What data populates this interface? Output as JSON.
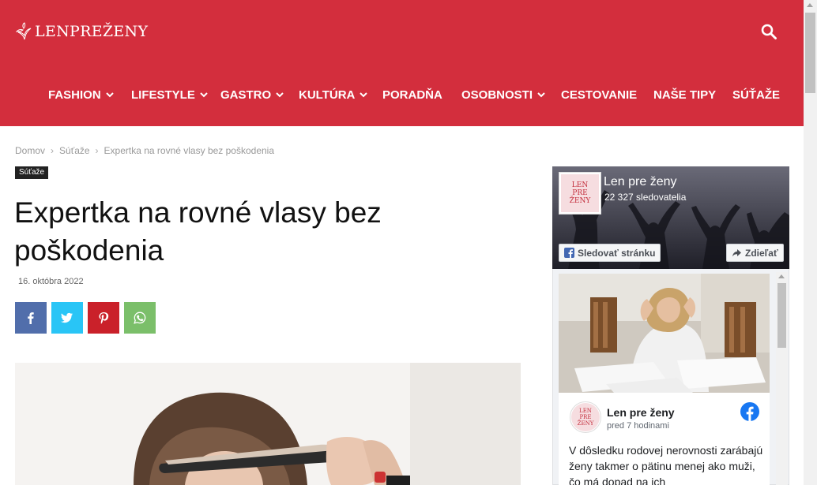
{
  "header": {
    "logo_text": "LENPREŽENY",
    "nav": [
      {
        "label": "FASHION",
        "has_dropdown": true
      },
      {
        "label": "LIFESTYLE",
        "has_dropdown": true
      },
      {
        "label": "GASTRO",
        "has_dropdown": true
      },
      {
        "label": "KULTÚRA",
        "has_dropdown": true
      },
      {
        "label": "PORADŇA",
        "has_dropdown": false
      },
      {
        "label": "OSOBNOSTI",
        "has_dropdown": true
      },
      {
        "label": "CESTOVANIE",
        "has_dropdown": false
      },
      {
        "label": "NAŠE TIPY",
        "has_dropdown": false
      },
      {
        "label": "SÚŤAŽE",
        "has_dropdown": false
      }
    ],
    "brand_color": "#d32e3d"
  },
  "breadcrumb": [
    "Domov",
    "Súťaže",
    "Expertka na rovné vlasy bez poškodenia"
  ],
  "article": {
    "category": "Súťaže",
    "title_line1": "Expertka na rovné vlasy bez",
    "title_line2": "poškodenia",
    "date": "16. októbra 2022",
    "share": [
      {
        "network": "facebook",
        "icon": "facebook-icon",
        "color": "#516eab"
      },
      {
        "network": "twitter",
        "icon": "twitter-icon",
        "color": "#29c5f6"
      },
      {
        "network": "pinterest",
        "icon": "pinterest-icon",
        "color": "#ca212a"
      },
      {
        "network": "whatsapp",
        "icon": "whatsapp-icon",
        "color": "#7bbf6a"
      }
    ]
  },
  "sidebar": {
    "fb_page": {
      "name": "Len pre ženy",
      "followers": "22 327 sledovatelia",
      "follow_label": "Sledovať stránku",
      "share_label": "Zdieľať",
      "avatar_text": [
        "LEN",
        "PRE",
        "ŽENY"
      ]
    },
    "post": {
      "author": "Len pre ženy",
      "time": "pred 7 hodinami",
      "text": "V dôsledku rodovej nerovnosti zarábajú ženy takmer o pätinu menej ako muži, čo má dopad na ich"
    }
  }
}
